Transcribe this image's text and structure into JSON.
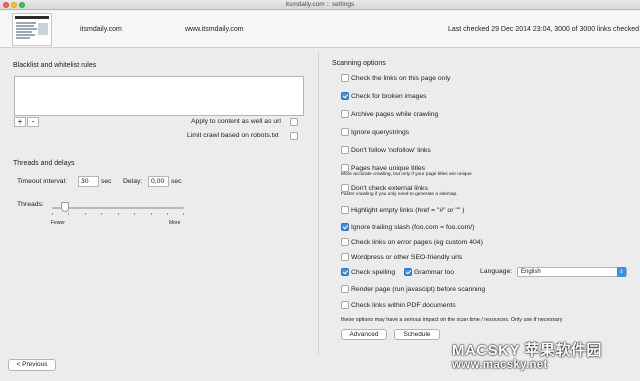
{
  "window": {
    "title": "itsmdaily.com :: settings"
  },
  "header": {
    "site_name": "itsmdaily.com",
    "site_url": "www.itsmdaily.com",
    "last_checked": "Last checked 29 Dec 2014 23:04, 3000 of 3000 links checked"
  },
  "left": {
    "rules_title": "Blacklist and whitelist rules",
    "add_label": "+",
    "remove_label": "-",
    "apply_content_label": "Apply to content as well as url",
    "apply_content_checked": false,
    "robots_label": "Limit crawl based on robots.txt",
    "robots_checked": false,
    "threads_title": "Threads and delays",
    "timeout_label": "Timeout interval:",
    "timeout_value": "30",
    "timeout_unit": "sec",
    "delay_label": "Delay:",
    "delay_value": "0,00",
    "delay_unit": "sec",
    "threads_label": "Threads:",
    "threads_level": 0.1,
    "fewer_label": "Fewer",
    "more_label": "More"
  },
  "right": {
    "title": "Scanning options",
    "options": [
      {
        "label": "Check the links on this page only",
        "checked": false
      },
      {
        "label": "Check for broken images",
        "checked": true
      },
      {
        "label": "Archive pages while crawling",
        "checked": false
      },
      {
        "label": "Ignore querystrings",
        "checked": false
      },
      {
        "label": "Don't follow 'nofollow' links",
        "checked": false
      },
      {
        "label": "Pages have unique titles",
        "checked": false,
        "note": "More accurate crawling, but only if your page titles are unique"
      },
      {
        "label": "Don't check external links",
        "checked": false,
        "note": "Faster crawling if you only need to generate a sitemap."
      },
      {
        "label": "Highlight empty links (href = \"#\"  or  \"\" )",
        "checked": false
      },
      {
        "label": "Ignore trailing slash (foo.com = foo.com/)",
        "checked": true
      },
      {
        "label": "Check links on error pages (eg custom 404)",
        "checked": false
      },
      {
        "label": "Wordpress or other SEO-friendly urls",
        "checked": false
      }
    ],
    "spelling_label": "Check spelling",
    "spelling_checked": true,
    "grammar_label": "Grammar too",
    "grammar_checked": true,
    "language_label": "Language:",
    "language_value": "English",
    "render_label": "Render page (run javascipt) before scanning",
    "render_checked": false,
    "pdf_label": "Check links within PDF documents",
    "pdf_checked": false,
    "warning": "these options may have a serious impact on the scan time / resources. Only use if necessary",
    "advanced_label": "Advanced",
    "schedule_label": "Schedule"
  },
  "footer": {
    "previous_label": "< Previous"
  },
  "watermark": {
    "line1": "MACSKY 苹果软件园",
    "line2": "www.macsky.net"
  }
}
